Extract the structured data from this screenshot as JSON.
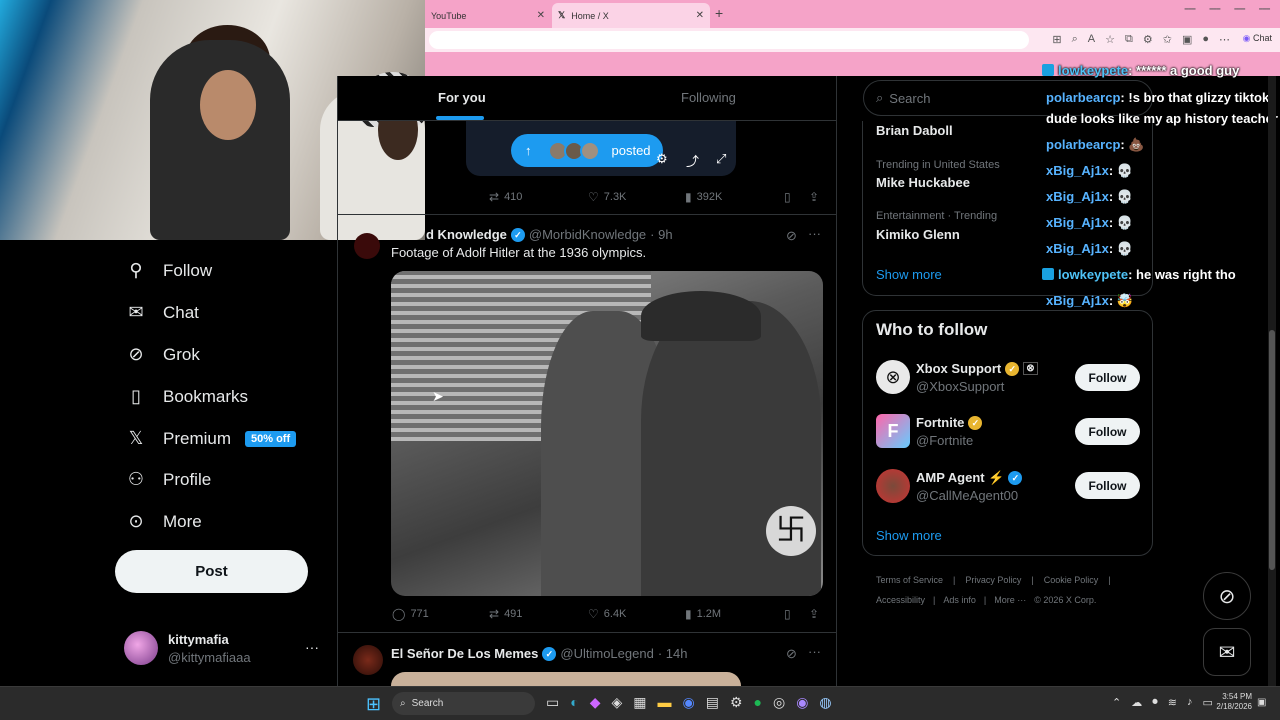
{
  "browser": {
    "tabs": [
      {
        "label": "YouTube"
      },
      {
        "label": "Home / X"
      }
    ],
    "chat_label": "Chat"
  },
  "nav": {
    "items": [
      {
        "label": "Follow",
        "icon": "person-plus-icon"
      },
      {
        "label": "Chat",
        "icon": "mail-icon"
      },
      {
        "label": "Grok",
        "icon": "grok-icon"
      },
      {
        "label": "Bookmarks",
        "icon": "bookmark-icon"
      },
      {
        "label": "Premium",
        "icon": "x-logo-icon",
        "badge": "50% off"
      },
      {
        "label": "Profile",
        "icon": "person-icon"
      },
      {
        "label": "More",
        "icon": "more-circle-icon"
      }
    ],
    "post_label": "Post",
    "account": {
      "name": "kittymafia",
      "handle": "@kittymafiaaa"
    }
  },
  "feed": {
    "tabs": [
      {
        "label": "For you"
      },
      {
        "label": "Following"
      }
    ],
    "posted_label": "posted",
    "tweet0": {
      "retweets": "410",
      "likes": "7.3K",
      "views": "392K"
    },
    "tweet1": {
      "name": "d Knowledge",
      "handle": "@MorbidKnowledge",
      "time": "· 9h",
      "text": "Footage of Adolf Hitler at the 1936 olympics.",
      "replies": "771",
      "retweets": "491",
      "likes": "6.4K",
      "views": "1.2M"
    },
    "tweet2": {
      "name": "El Señor De Los Memes",
      "handle": "@UltimoLegend",
      "time": "· 14h"
    }
  },
  "sidebar": {
    "search_placeholder": "Search",
    "trends": [
      {
        "meta": "",
        "topic": "Brian Daboll"
      },
      {
        "meta": "Trending in United States",
        "topic": "Mike Huckabee"
      },
      {
        "meta": "Entertainment · Trending",
        "topic": "Kimiko Glenn"
      }
    ],
    "show_more": "Show more",
    "who_to_follow": {
      "title": "Who to follow",
      "accounts": [
        {
          "name": "Xbox Support",
          "handle": "@XboxSupport",
          "button": "Follow"
        },
        {
          "name": "Fortnite",
          "handle": "@Fortnite",
          "button": "Follow"
        },
        {
          "name": "AMP Agent ⚡",
          "handle": "@CallMeAgent00",
          "button": "Follow"
        }
      ],
      "show_more": "Show more"
    },
    "footer": [
      "Terms of Service",
      "|",
      "Privacy Policy",
      "|",
      "Cookie Policy",
      "|",
      "Accessibility",
      "|",
      "Ads info",
      "|",
      "More ···",
      "© 2026 X Corp."
    ]
  },
  "stream_chat": [
    {
      "user": "lowkeypete",
      "msg": ": ****** a good guy",
      "badge": true
    },
    {
      "user": "polarbearcp",
      "msg": ": !s bro that glizzy tiktok dude looks like my ap history teacher",
      "badge": false
    },
    {
      "user": "polarbearcp",
      "msg": ": 💩",
      "badge": false
    },
    {
      "user": "xBig_Aj1x",
      "msg": ": 💀",
      "badge": false
    },
    {
      "user": "xBig_Aj1x",
      "msg": ": 💀",
      "badge": false
    },
    {
      "user": "xBig_Aj1x",
      "msg": ": 💀",
      "badge": false
    },
    {
      "user": "xBig_Aj1x",
      "msg": ": 💀",
      "badge": false
    },
    {
      "user": "lowkeypete",
      "msg": ": he was right tho",
      "badge": true
    },
    {
      "user": "xBig_Aj1x",
      "msg": ": 🤯",
      "badge": false
    }
  ],
  "taskbar": {
    "search_label": "Search",
    "time": "3:54 PM",
    "date": "2/18/2026"
  },
  "colors": {
    "accent": "#1d9bf0",
    "tab_pink": "#f5a3c8"
  }
}
